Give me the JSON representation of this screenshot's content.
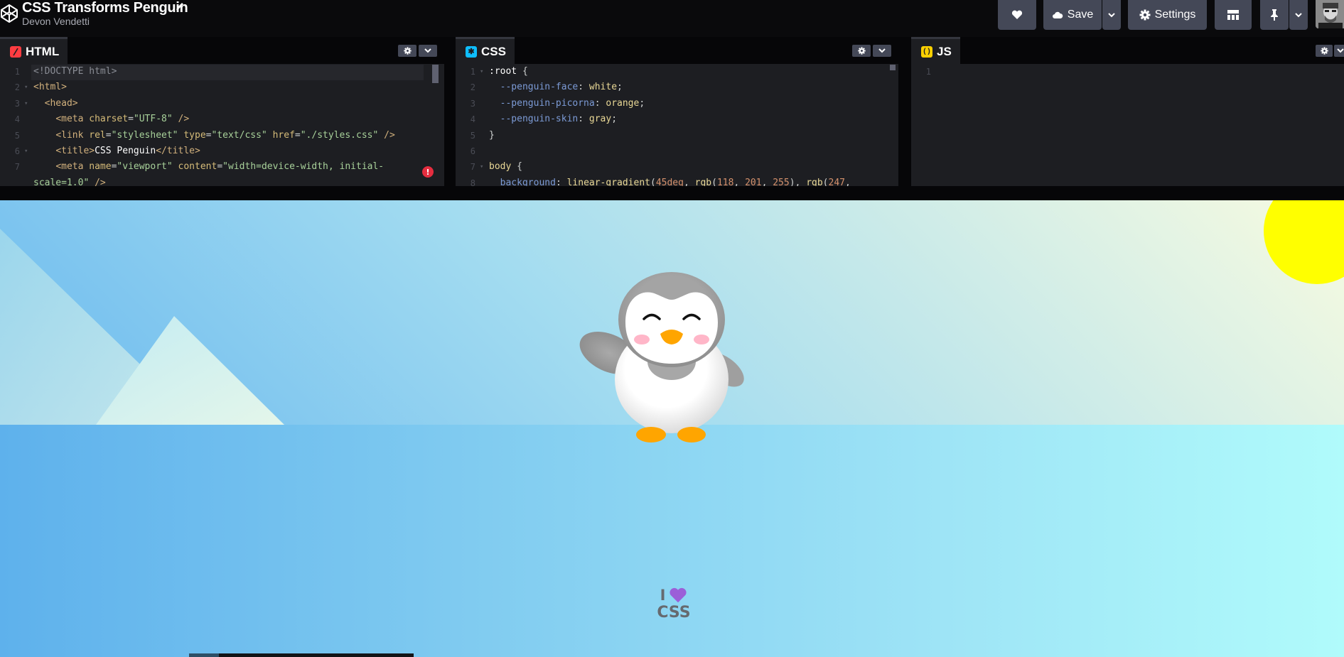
{
  "header": {
    "title": "CSS Transforms Penguin",
    "author": "Devon Vendetti",
    "buttons": {
      "save_label": "Save",
      "settings_label": "Settings"
    }
  },
  "editors": {
    "html": {
      "label": "HTML",
      "icon_color": "#ff3c41",
      "lines": [
        {
          "n": "1",
          "fold": "",
          "html": "<span class=\"t-dim\">&lt;!DOCTYPE html&gt;</span>"
        },
        {
          "n": "2",
          "fold": "▾",
          "html": "<span class=\"t-tag\">&lt;html&gt;</span>"
        },
        {
          "n": "3",
          "fold": "▾",
          "html": "  <span class=\"t-tag\">&lt;head&gt;</span>"
        },
        {
          "n": "4",
          "fold": "",
          "html": "    <span class=\"t-tag\">&lt;meta</span> <span class=\"t-attr\">charset</span>=<span class=\"t-str\">\"UTF-8\"</span> <span class=\"t-tag\">/&gt;</span>"
        },
        {
          "n": "5",
          "fold": "",
          "html": "    <span class=\"t-tag\">&lt;link</span> <span class=\"t-attr\">rel</span>=<span class=\"t-str\">\"stylesheet\"</span> <span class=\"t-attr\">type</span>=<span class=\"t-str\">\"text/css\"</span> <span class=\"t-attr\">href</span>=<span class=\"t-str\">\"./styles.css\"</span> <span class=\"t-tag\">/&gt;</span>"
        },
        {
          "n": "6",
          "fold": "▾",
          "html": "    <span class=\"t-tag\">&lt;title&gt;</span><span class=\"t-sel\">CSS Penguin</span><span class=\"t-tag\">&lt;/title&gt;</span>"
        },
        {
          "n": "7",
          "fold": "",
          "html": "    <span class=\"t-tag\">&lt;meta</span> <span class=\"t-attr\">name</span>=<span class=\"t-str\">\"viewport\"</span> <span class=\"t-attr\">content</span>=<span class=\"t-str\">\"width=device-width, initial-</span>"
        },
        {
          "n": "",
          "fold": "",
          "html": "<span class=\"t-str\">scale=1.0\"</span> <span class=\"t-tag\">/&gt;</span>"
        }
      ]
    },
    "css": {
      "label": "CSS",
      "icon_color": "#0ebeff",
      "lines": [
        {
          "n": "1",
          "fold": "▾",
          "html": "<span class=\"t-sel\">:root</span> {"
        },
        {
          "n": "2",
          "fold": "",
          "html": "  <span class=\"t-prop\">--penguin-face</span>: <span class=\"t-val\">white</span>;"
        },
        {
          "n": "3",
          "fold": "",
          "html": "  <span class=\"t-prop\">--penguin-picorna</span>: <span class=\"t-val\">orange</span>;"
        },
        {
          "n": "4",
          "fold": "",
          "html": "  <span class=\"t-prop\">--penguin-skin</span>: <span class=\"t-val\">gray</span>;"
        },
        {
          "n": "5",
          "fold": "",
          "html": "}"
        },
        {
          "n": "6",
          "fold": "",
          "html": ""
        },
        {
          "n": "7",
          "fold": "▾",
          "html": "<span class=\"t-val\">body</span> {"
        },
        {
          "n": "8",
          "fold": "",
          "html": "  <span class=\"t-prop\">background</span>: <span class=\"t-val\">linear-gradient</span>(<span class=\"t-num\">45deg</span>, <span class=\"t-val\">rgb</span>(<span class=\"t-num\">118</span>, <span class=\"t-num\">201</span>, <span class=\"t-num\">255</span>), <span class=\"t-val\">rgb</span>(<span class=\"t-num\">247</span>,"
        }
      ]
    },
    "js": {
      "label": "JS",
      "icon_color": "#fcd000",
      "lines": [
        {
          "n": "1",
          "fold": "",
          "html": ""
        }
      ]
    }
  },
  "preview": {
    "shirt_line1": "I",
    "shirt_line2": "CSS",
    "colors": {
      "sun": "#ffff00",
      "heart": "#9b5fd8",
      "penguin_face": "#ffffff",
      "penguin_beak": "#ffa500",
      "penguin_skin": "#808080"
    }
  }
}
